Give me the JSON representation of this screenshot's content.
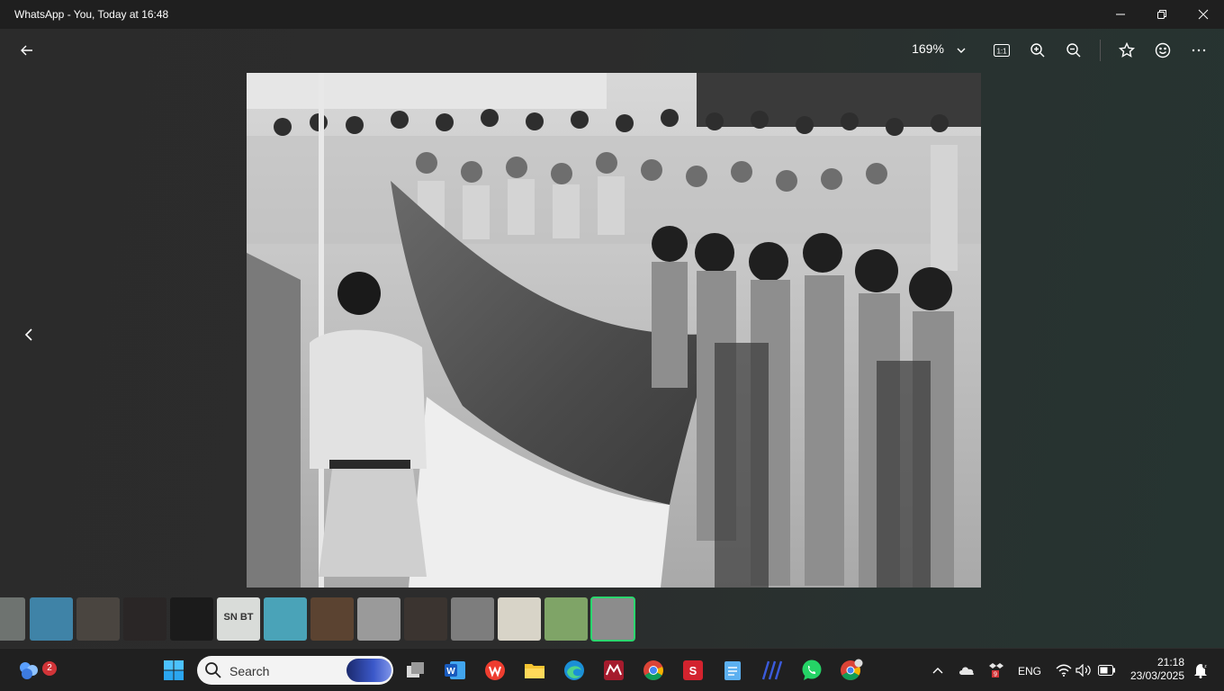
{
  "window": {
    "title": "WhatsApp - You, Today at 16:48",
    "controls": [
      "minimize-icon",
      "restore-icon",
      "close-icon"
    ]
  },
  "viewer_toolbar": {
    "back_icon": "arrow-left-icon",
    "zoom_level": "169%",
    "zoom_dropdown_icon": "chevron-down-icon",
    "actual_size_icon": "actual-size-icon",
    "actual_size_label": "1:1",
    "zoom_in_icon": "zoom-in-icon",
    "zoom_out_icon": "zoom-out-icon",
    "star_icon": "star-icon",
    "emoji_icon": "emoji-icon",
    "more_icon": "more-icon"
  },
  "photo": {
    "description_icon": "black-and-white-photo-flag-ceremony"
  },
  "filmstrip": {
    "thumbnails": [
      {
        "name": "thumb-1",
        "color": "#6e7370"
      },
      {
        "name": "thumb-2",
        "color": "#3f83a7"
      },
      {
        "name": "thumb-3",
        "color": "#4a4540"
      },
      {
        "name": "thumb-4",
        "color": "#2a2626"
      },
      {
        "name": "thumb-5",
        "color": "#1b1b1b"
      },
      {
        "name": "thumb-6",
        "color": "#d9dcd9",
        "text": "SN BT"
      },
      {
        "name": "thumb-7",
        "color": "#4aa3b8"
      },
      {
        "name": "thumb-8",
        "color": "#5b4331"
      },
      {
        "name": "thumb-9",
        "color": "#9a9a9a"
      },
      {
        "name": "thumb-10",
        "color": "#3b3430"
      },
      {
        "name": "thumb-11",
        "color": "#7d7d7d"
      },
      {
        "name": "thumb-12",
        "color": "#d8d4c8"
      },
      {
        "name": "thumb-13",
        "color": "#7fa467"
      },
      {
        "name": "thumb-14",
        "color": "#8c8c8c",
        "selected": true
      }
    ]
  },
  "taskbar": {
    "widgets_badge": "2",
    "search_label": "Search",
    "apps": [
      "start-icon",
      "search",
      "task-view-icon",
      "word-icon",
      "wps-icon",
      "file-explorer-icon",
      "edge-icon",
      "mendeley-icon",
      "chrome-icon",
      "smadav-icon",
      "notepad-icon",
      "sound-blaster-icon",
      "whatsapp-icon",
      "chrome-profile-icon"
    ],
    "tray": {
      "chevron_icon": "chevron-up-icon",
      "onedrive_icon": "cloud-icon",
      "app_icon": "dropbox-icon",
      "language": "ENG",
      "wifi_icon": "wifi-icon",
      "volume_icon": "volume-icon",
      "battery_icon": "battery-icon",
      "time": "21:18",
      "date": "23/03/2025",
      "notification_icon": "notification-icon"
    }
  }
}
